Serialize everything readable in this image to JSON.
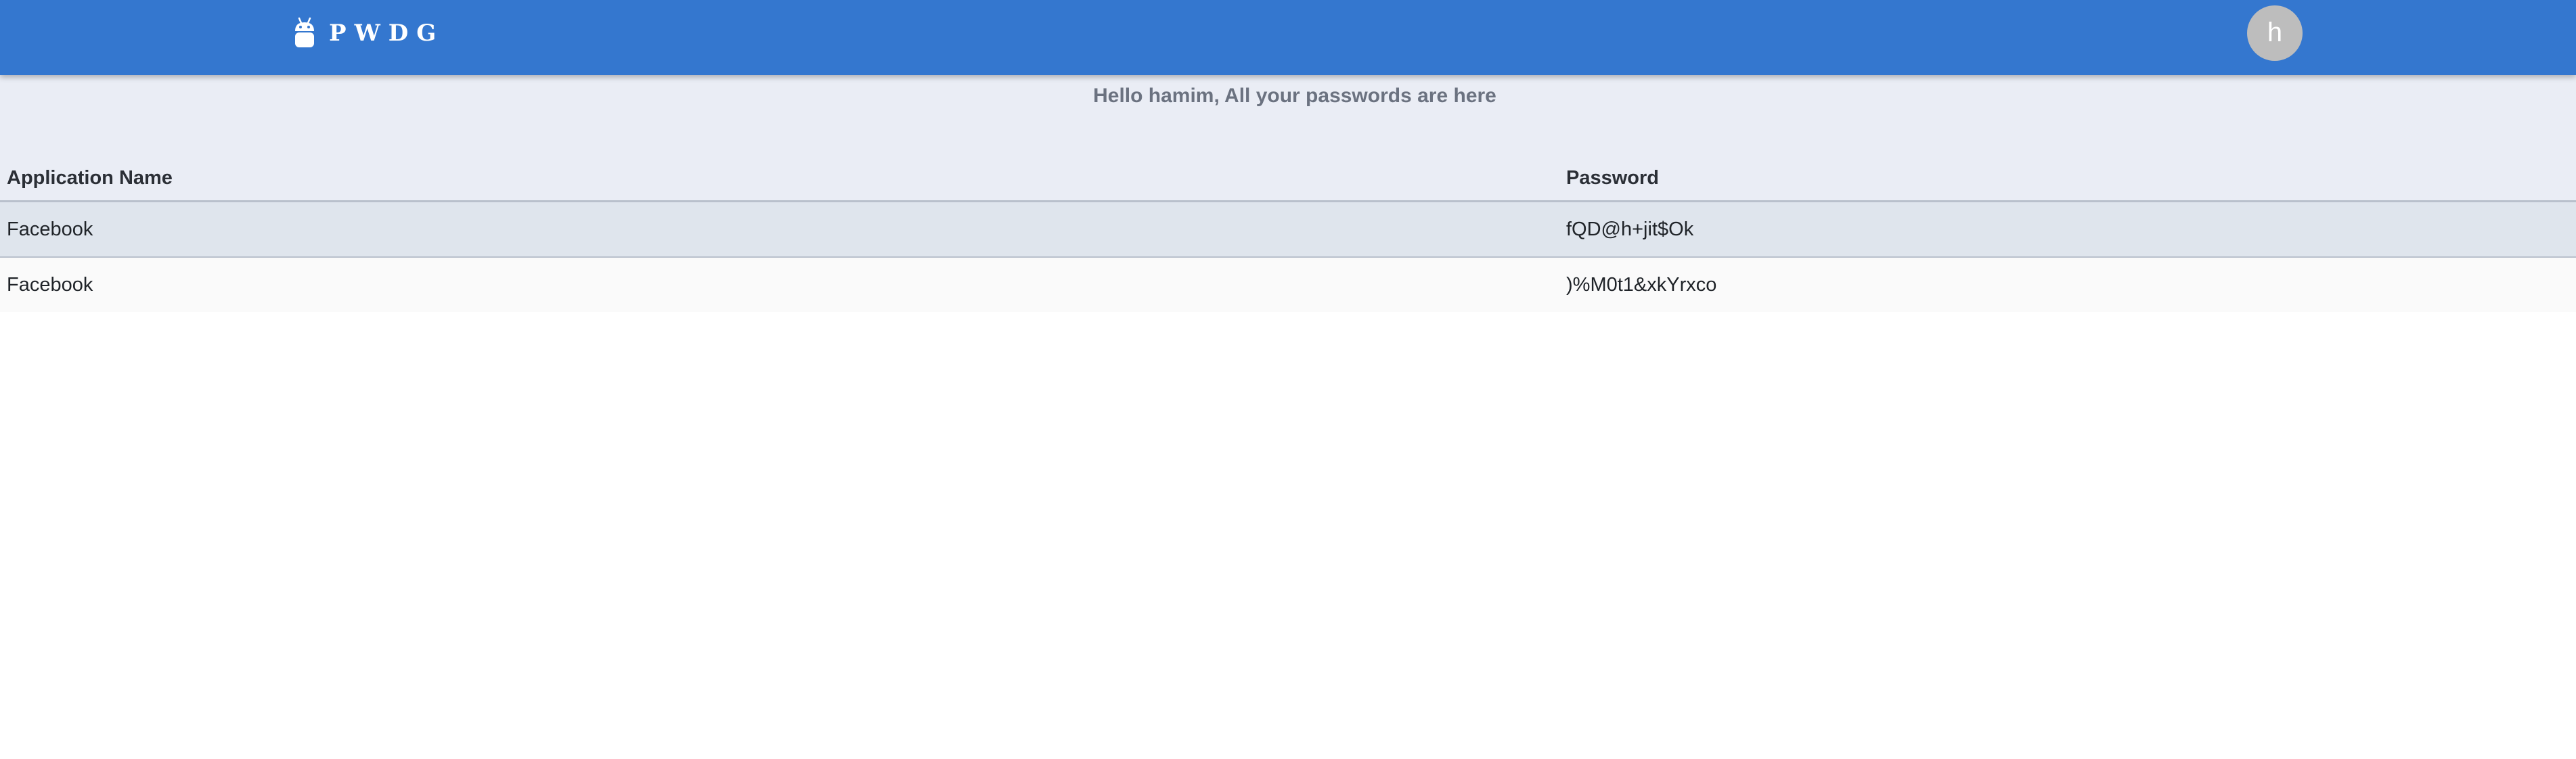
{
  "navbar": {
    "brand_name": "PWDG",
    "brand_icon": "android-icon",
    "avatar_initial": "h",
    "bar_color": "#3477cf"
  },
  "greeting": "Hello hamim, All your passwords are here",
  "table": {
    "headers": {
      "application": "Application Name",
      "password": "Password"
    },
    "rows": [
      {
        "application": "Facebook",
        "password": "fQD@h+jit$Ok"
      },
      {
        "application": "Facebook",
        "password": ")%M0t1&xkYrxco"
      }
    ]
  }
}
